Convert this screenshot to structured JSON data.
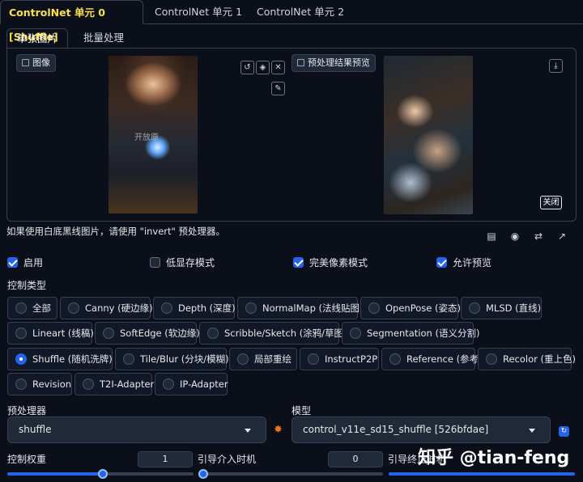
{
  "tabs": [
    "ControlNet 单元 0 [Shuffle]",
    "ControlNet 单元 1",
    "ControlNet 单元 2"
  ],
  "subtabs": [
    "单张图片",
    "批量处理"
  ],
  "image_panel": {
    "image_label": "图像",
    "preview_label": "预处理结果预览",
    "close_label": "关闭",
    "image_watermark": "开放原"
  },
  "hint": "如果使用白底黑线图片，请使用 \"invert\" 预处理器。",
  "checkboxes": [
    {
      "label": "启用",
      "checked": true
    },
    {
      "label": "低显存模式",
      "checked": false
    },
    {
      "label": "完美像素模式",
      "checked": true
    },
    {
      "label": "允许预览",
      "checked": true
    }
  ],
  "control_type_label": "控制类型",
  "control_types": [
    {
      "label": "全部",
      "selected": false
    },
    {
      "label": "Canny (硬边缘)",
      "selected": false
    },
    {
      "label": "Depth (深度)",
      "selected": false
    },
    {
      "label": "NormalMap (法线贴图)",
      "selected": false
    },
    {
      "label": "OpenPose (姿态)",
      "selected": false
    },
    {
      "label": "MLSD (直线)",
      "selected": false
    },
    {
      "label": "Lineart (线稿)",
      "selected": false
    },
    {
      "label": "SoftEdge (软边缘)",
      "selected": false
    },
    {
      "label": "Scribble/Sketch (涂鸦/草图)",
      "selected": false
    },
    {
      "label": "Segmentation (语义分割)",
      "selected": false
    },
    {
      "label": "Shuffle (随机洗牌)",
      "selected": true
    },
    {
      "label": "Tile/Blur (分块/模糊)",
      "selected": false
    },
    {
      "label": "局部重绘",
      "selected": false
    },
    {
      "label": "InstructP2P",
      "selected": false
    },
    {
      "label": "Reference (参考)",
      "selected": false
    },
    {
      "label": "Recolor (重上色)",
      "selected": false
    },
    {
      "label": "Revision",
      "selected": false
    },
    {
      "label": "T2I-Adapter",
      "selected": false
    },
    {
      "label": "IP-Adapter",
      "selected": false
    }
  ],
  "preprocessor": {
    "label": "预处理器",
    "value": "shuffle"
  },
  "model": {
    "label": "模型",
    "value": "control_v11e_sd15_shuffle [526bfdae]"
  },
  "weights": {
    "weight_label": "控制权重",
    "weight_value": "1",
    "start_label": "引导介入时机",
    "start_value": "0",
    "end_label": "引导终止时机"
  },
  "watermark": "知乎 @tian-feng",
  "colors": {
    "accent": "#2563eb",
    "active_tab": "#fde047",
    "background": "#0b0f19"
  }
}
